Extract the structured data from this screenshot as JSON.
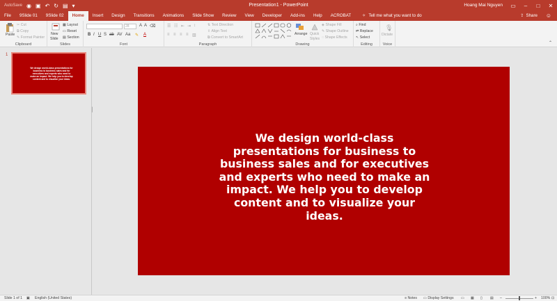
{
  "titlebar": {
    "autosave": "AutoSave",
    "title": "Presentation1  -  PowerPoint",
    "user": "Hoang Mai Nguyen"
  },
  "tabs": [
    {
      "label": "File"
    },
    {
      "label": "9Slide 01"
    },
    {
      "label": "9Slide 02"
    },
    {
      "label": "Home",
      "active": true
    },
    {
      "label": "Insert"
    },
    {
      "label": "Design"
    },
    {
      "label": "Transitions"
    },
    {
      "label": "Animations"
    },
    {
      "label": "Slide Show"
    },
    {
      "label": "Review"
    },
    {
      "label": "View"
    },
    {
      "label": "Developer"
    },
    {
      "label": "Add-ins"
    },
    {
      "label": "Help"
    },
    {
      "label": "ACROBAT"
    }
  ],
  "tell_me": "Tell me what you want to do",
  "share": "Share",
  "ribbon": {
    "clipboard": {
      "label": "Clipboard",
      "paste": "Paste",
      "cut": "Cut",
      "copy": "Copy",
      "format_painter": "Format Painter"
    },
    "slides": {
      "label": "Slides",
      "new_slide": "New",
      "new_slide2": "Slide",
      "layout": "Layout",
      "reset": "Reset",
      "section": "Section"
    },
    "font": {
      "label": "Font",
      "size": "28"
    },
    "paragraph": {
      "label": "Paragraph",
      "text_direction": "Text Direction",
      "align_text": "Align Text",
      "smartart": "Convert to SmartArt"
    },
    "drawing": {
      "label": "Drawing",
      "arrange": "Arrange",
      "quick_styles": "Quick",
      "quick_styles2": "Styles",
      "shape_fill": "Shape Fill",
      "shape_outline": "Shape Outline",
      "shape_effects": "Shape Effects"
    },
    "editing": {
      "label": "Editing",
      "find": "Find",
      "replace": "Replace",
      "select": "Select"
    },
    "voice": {
      "label": "Voice",
      "dictate": "Dictate"
    }
  },
  "thumbnail": {
    "number": "1",
    "text": "We design world-class presentations for business to business sales and for executives and experts who need to make an impact. We help you to develop content and to visualize your ideas."
  },
  "slide": {
    "text": "We design world-class presentations for business to business sales and for executives and experts who need to make an impact. We help you to develop content and to visualize your ideas.",
    "background": "#b00000"
  },
  "status": {
    "slide_count": "Slide 1 of 1",
    "language": "English (United States)",
    "notes": "Notes",
    "display_settings": "Display Settings",
    "zoom": "100%"
  },
  "colors": {
    "accent": "#b83b2c",
    "slide_bg": "#b00000"
  }
}
